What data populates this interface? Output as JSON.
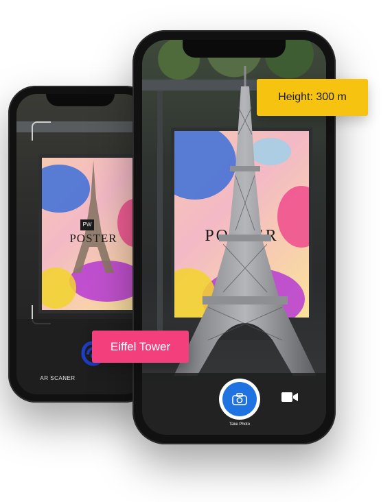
{
  "back_phone": {
    "poster_title": "POSTER",
    "poster_initials": "PW",
    "scanner_label": "AR SCANER",
    "scanner_icon": "ar-scanner-icon"
  },
  "front_phone": {
    "poster_title": "POSTER",
    "camera_button_icon": "camera-icon",
    "camera_button_label": "Take Photo",
    "video_button_icon": "video-camera-icon"
  },
  "labels": {
    "object_name": "Eiffel Tower",
    "height_key": "Height:",
    "height_value": "300 m"
  },
  "colors": {
    "label_pink": "#f43f7d",
    "label_yellow": "#f6c410",
    "camera_button_blue": "#1f73e0"
  }
}
